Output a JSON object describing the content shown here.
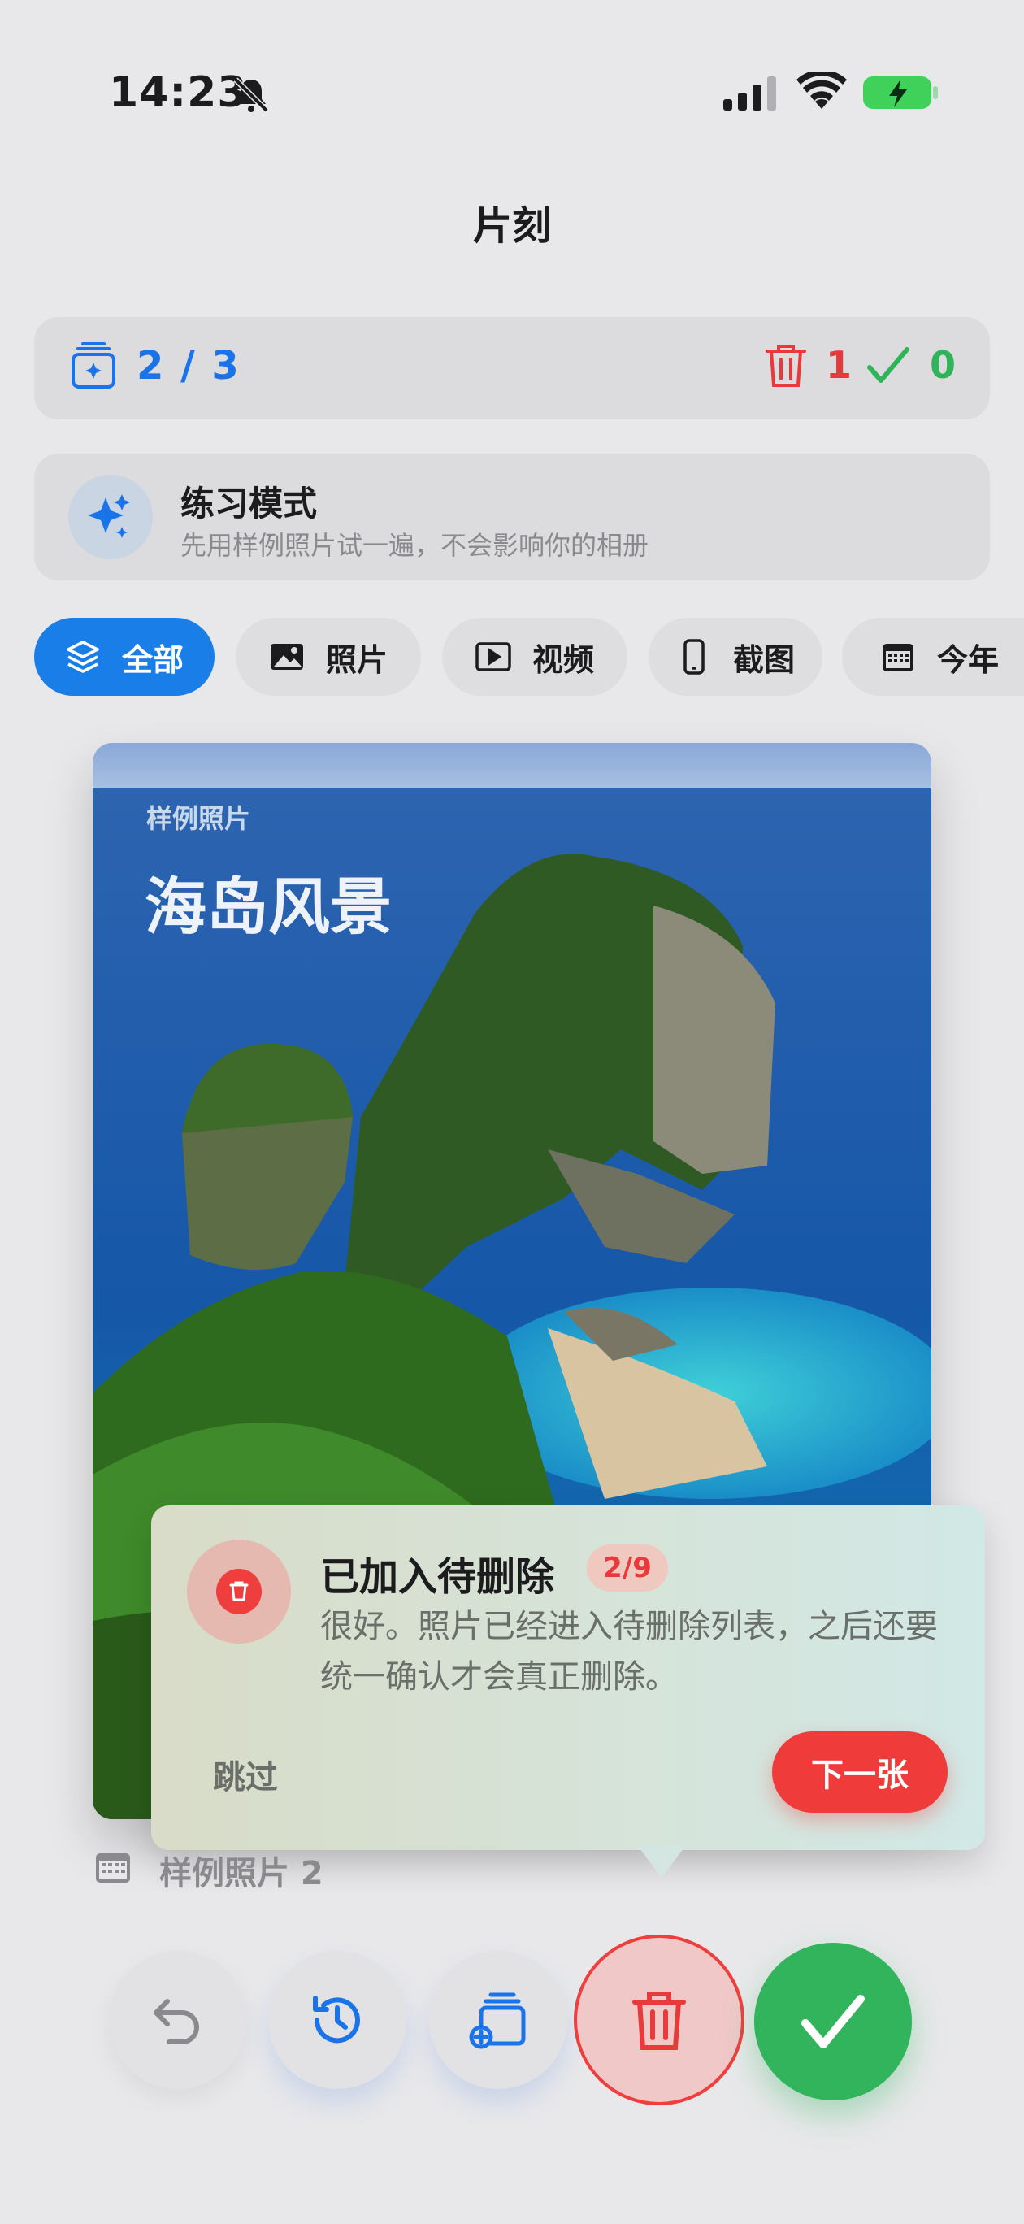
{
  "status_bar": {
    "time": "14:23"
  },
  "header": {
    "title": "片刻"
  },
  "progress": {
    "position": "2 / 3",
    "delete_count": "1",
    "keep_count": "0"
  },
  "practice": {
    "title": "练习模式",
    "subtitle": "先用样例照片试一遍，不会影响你的相册"
  },
  "filters": [
    {
      "label": "全部",
      "icon": "layers-icon",
      "active": true
    },
    {
      "label": "照片",
      "icon": "image-icon",
      "active": false
    },
    {
      "label": "视频",
      "icon": "play-icon",
      "active": false
    },
    {
      "label": "截图",
      "icon": "phone-icon",
      "active": false
    },
    {
      "label": "今年",
      "icon": "calendar-icon",
      "active": false
    }
  ],
  "photo": {
    "label": "样例照片",
    "title": "海岛风景",
    "caption": "样例照片 2"
  },
  "popup": {
    "title": "已加入待删除",
    "badge": "2/9",
    "body": "很好。照片已经进入待删除列表，之后还要统一确认才会真正删除。",
    "skip": "跳过",
    "next": "下一张"
  },
  "actions": [
    "undo-icon",
    "history-icon",
    "add-to-album-icon",
    "trash-icon",
    "checkmark-icon"
  ],
  "colors": {
    "accent": "#1a7ee8",
    "delete": "#ee3e3e",
    "keep": "#32b45c"
  }
}
